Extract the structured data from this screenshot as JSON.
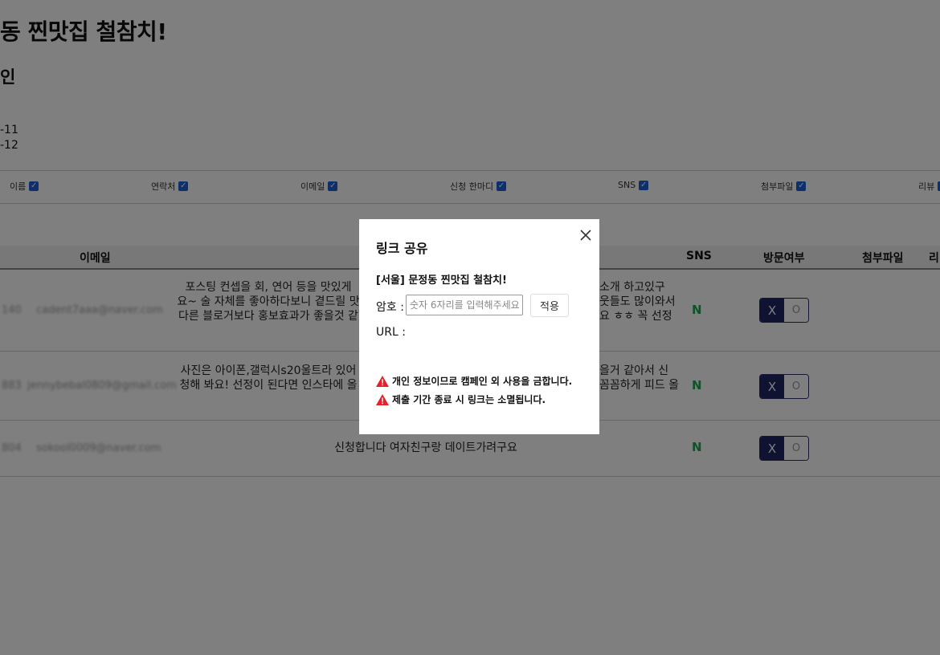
{
  "page": {
    "title": "동 찐맛집 철참치!",
    "subtitle": "인",
    "date_start": "-11",
    "date_end": "-12"
  },
  "filters": [
    {
      "label": "이름"
    },
    {
      "label": "연락처"
    },
    {
      "label": "이메일"
    },
    {
      "label": "신청 한마디"
    },
    {
      "label": "SNS"
    },
    {
      "label": "첨부파일"
    },
    {
      "label": "리뷰"
    }
  ],
  "table": {
    "headers": {
      "email": "이메일",
      "sns": "SNS",
      "visit": "방문여부",
      "attachment": "첨부파일",
      "review": "리"
    },
    "rows": [
      {
        "id": "140",
        "email": "cadent7aaa@naver.com",
        "message_lines": [
          "포스팅 컨셉을 회, 연어 등을 맛있게",
          "요~ 술 자체를 좋아하다보니 곁드릴 맛",
          "다른 블로거보다 홍보효과가 좋을것 같"
        ],
        "message_right_lines": [
          "소개 하고있구",
          "웃들도 많이와서",
          "요 ㅎㅎ 꼭 선정"
        ],
        "sns": "N",
        "toggle_on": "X",
        "toggle_off": "O"
      },
      {
        "id": "883",
        "email": "jennybebal0809@gmail.com",
        "message_lines": [
          "사진은 아이폰,갤럭시s20울트라 있어",
          "청해 봐요! 선정이 된다면 인스타에 올"
        ],
        "message_right_lines": [
          "을거 같아서 신",
          "꼼꼼하게 피드 올"
        ],
        "sns": "N",
        "toggle_on": "X",
        "toggle_off": "O"
      },
      {
        "id": "804",
        "email": "sokool0009@naver.com",
        "message_lines": [
          "신청합니다 여자친구랑 데이트가려구요"
        ],
        "message_right_lines": [],
        "sns": "N",
        "toggle_on": "X",
        "toggle_off": "O"
      }
    ]
  },
  "modal": {
    "title": "링크 공유",
    "campaign_name": "[서울] 문정동 찐맛집 철참치!",
    "password_label": "암호 :",
    "password_placeholder": "숫자 6자리를 입력해주세요",
    "password_value": "",
    "apply_label": "적용",
    "url_label": "URL :",
    "url_value": "",
    "warnings": [
      "개인 정보이므로 캠페인 외 사용을 금합니다.",
      "제출 기간 종료 시 링크는 소멸됩니다."
    ]
  },
  "colors": {
    "overlay": "rgba(0,0,0,0.5)",
    "toggle_active": "#1e2463",
    "sns_naver": "#19a84a",
    "checkbox": "#1a5fd6",
    "warning": "#e8202a"
  },
  "icons": {
    "close": "close-icon",
    "warning": "warning-triangle-icon",
    "checkbox": "checkbox-checked-icon"
  }
}
